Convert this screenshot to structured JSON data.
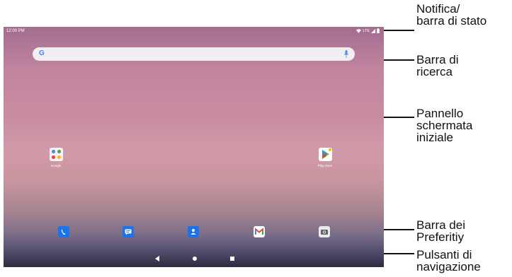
{
  "status_bar": {
    "time": "12:00 PM",
    "network": "LTE",
    "icons": [
      "wifi-icon",
      "signal-icon",
      "battery-icon"
    ]
  },
  "search": {
    "logo": "G",
    "icons": [
      "google-logo-icon",
      "mic-icon"
    ]
  },
  "home_apps": [
    {
      "label": "Google",
      "icon": "google-folder-icon"
    },
    {
      "label": "Play Store",
      "icon": "play-store-icon"
    }
  ],
  "dock": [
    {
      "name": "phone",
      "icon": "phone-icon",
      "color": "#1a73e8"
    },
    {
      "name": "messages",
      "icon": "messages-icon",
      "color": "#1a73e8"
    },
    {
      "name": "contacts",
      "icon": "contacts-icon",
      "color": "#1a73e8"
    },
    {
      "name": "gmail",
      "icon": "gmail-icon",
      "color": "#ffffff"
    },
    {
      "name": "camera",
      "icon": "camera-icon",
      "color": "#e8eaed"
    }
  ],
  "navigation": [
    "back-icon",
    "home-icon",
    "recents-icon"
  ],
  "callouts": {
    "status": "Notifica/\nbarra di stato",
    "search": "Barra di\nricerca",
    "home": "Pannello\nschermata\niniziale",
    "favorites": "Barra dei\nPreferitiy",
    "navigation": "Pulsanti di\nnavigazione"
  }
}
